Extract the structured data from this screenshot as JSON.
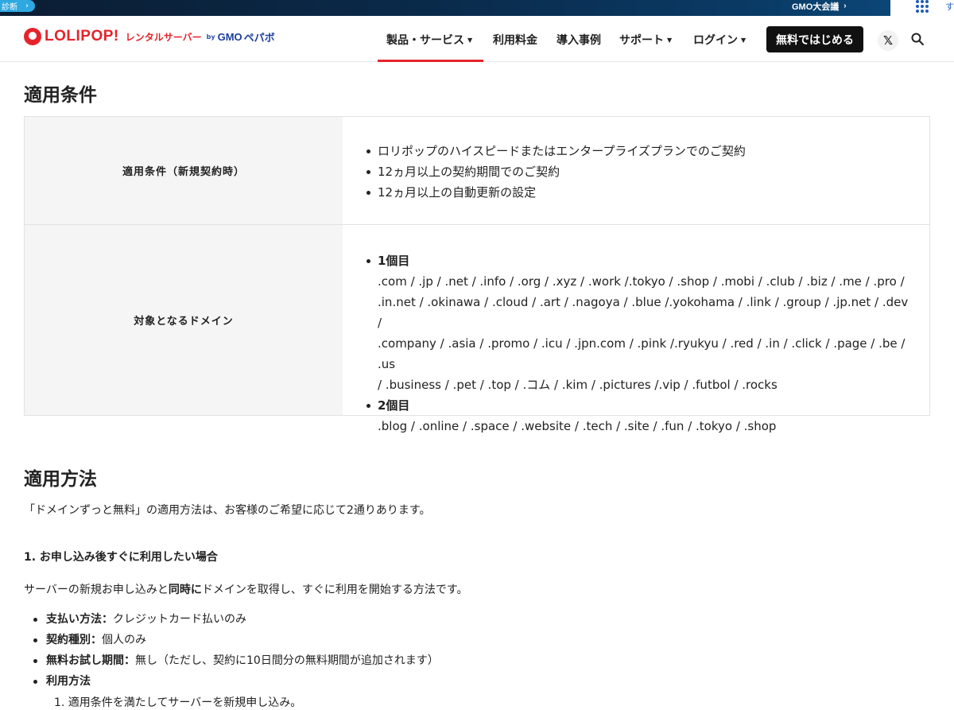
{
  "gmo_bar": {
    "left_label": "診断",
    "group_label": "GMO大会議",
    "right_char": "す"
  },
  "header": {
    "logo": {
      "brand": "LOLIPOP!",
      "sub": "レンタルサーバー",
      "by": "by",
      "gmo": "GMO",
      "pepabo": "ペパボ"
    },
    "nav": [
      {
        "label": "製品・サービス",
        "has_caret": true,
        "active": true
      },
      {
        "label": "利用料金",
        "has_caret": false
      },
      {
        "label": "導入事例",
        "has_caret": false
      },
      {
        "label": "サポート",
        "has_caret": true
      },
      {
        "label": "ログイン",
        "has_caret": true
      }
    ],
    "cta_label": "無料ではじめる",
    "x_icon": "x-logo-icon",
    "search_icon": "search-icon"
  },
  "conditions": {
    "heading": "適用条件",
    "rows": [
      {
        "label": "適用条件（新規契約時）",
        "items": [
          "ロリポップのハイスピードまたはエンタープライズプランでのご契約",
          "12ヵ月以上の契約期間でのご契約",
          "12ヵ月以上の自動更新の設定"
        ]
      },
      {
        "label": "対象となるドメイン",
        "groups": [
          {
            "title": "1個目",
            "domains": [
              ".com / .jp / .net / .info / .org / .xyz / .work /.tokyo / .shop / .mobi / .club / .biz / .me / .pro /",
              ".in.net / .okinawa / .cloud / .art / .nagoya / .blue /.yokohama / .link / .group / .jp.net / .dev /",
              ".company / .asia / .promo / .icu / .jpn.com / .pink /.ryukyu / .red / .in / .click / .page / .be / .us",
              "/ .business / .pet / .top / .コム / .kim / .pictures /.vip / .futbol / .rocks"
            ]
          },
          {
            "title": "2個目",
            "domains": [
              ".blog / .online / .space / .website / .tech / .site / .fun / .tokyo / .shop"
            ]
          }
        ]
      }
    ]
  },
  "method": {
    "heading": "適用方法",
    "intro": "「ドメインずっと無料」の適用方法は、お客様のご希望に応じて2通りあります。",
    "subheading": "1. お申し込み後すぐに利用したい場合",
    "desc_before": "サーバーの新規お申し込みと",
    "desc_bold": "同時に",
    "desc_after": "ドメインを取得し、すぐに利用を開始する方法です。",
    "items": [
      {
        "label": "支払い方法：",
        "value": "クレジットカード払いのみ"
      },
      {
        "label": "契約種別：",
        "value": "個人のみ"
      },
      {
        "label": "無料お試し期間：",
        "value": "無し（ただし、契約に10日間分の無料期間が追加されます）"
      },
      {
        "label": "利用方法",
        "value": ""
      }
    ],
    "steps": [
      "1. 適用条件を満たしてサーバーを新規申し込み。"
    ]
  }
}
